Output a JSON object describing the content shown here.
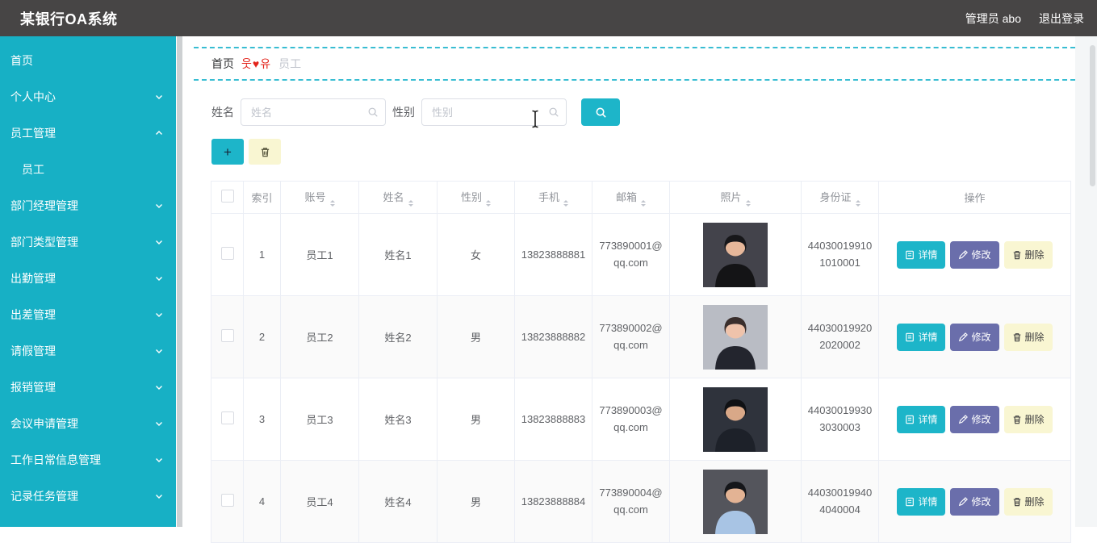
{
  "header": {
    "title": "某银行OA系统",
    "user": "管理员 abo",
    "logout": "退出登录"
  },
  "sidebar": {
    "items": [
      {
        "label": "首页",
        "arrow": ""
      },
      {
        "label": "个人中心",
        "arrow": "down"
      },
      {
        "label": "员工管理",
        "arrow": "up"
      },
      {
        "label": "员工",
        "arrow": "",
        "submenu": true
      },
      {
        "label": "部门经理管理",
        "arrow": "down"
      },
      {
        "label": "部门类型管理",
        "arrow": "down"
      },
      {
        "label": "出勤管理",
        "arrow": "down"
      },
      {
        "label": "出差管理",
        "arrow": "down"
      },
      {
        "label": "请假管理",
        "arrow": "down"
      },
      {
        "label": "报销管理",
        "arrow": "down"
      },
      {
        "label": "会议申请管理",
        "arrow": "down"
      },
      {
        "label": "工作日常信息管理",
        "arrow": "down"
      },
      {
        "label": "记录任务管理",
        "arrow": "down"
      }
    ]
  },
  "breadcrumb": {
    "home": "首页",
    "separator": "웃♥유",
    "current": "员工"
  },
  "search": {
    "name_label": "姓名",
    "name_placeholder": "姓名",
    "name_value": "",
    "gender_label": "性别",
    "gender_placeholder": "性别",
    "gender_value": ""
  },
  "toolbar": {
    "add_label": "+"
  },
  "table": {
    "columns": [
      {
        "label": "",
        "type": "checkbox"
      },
      {
        "label": "索引"
      },
      {
        "label": "账号",
        "sortable": true
      },
      {
        "label": "姓名",
        "sortable": true
      },
      {
        "label": "性别",
        "sortable": true
      },
      {
        "label": "手机",
        "sortable": true
      },
      {
        "label": "邮箱",
        "sortable": true
      },
      {
        "label": "照片",
        "sortable": true
      },
      {
        "label": "身份证",
        "sortable": true
      },
      {
        "label": "操作"
      }
    ],
    "actions": {
      "detail": "详情",
      "edit": "修改",
      "delete": "删除"
    },
    "rows": [
      {
        "index": "1",
        "account": "员工1",
        "name": "姓名1",
        "gender": "女",
        "phone": "13823888881",
        "email": "773890001@\nqq.com",
        "id_card": "44030019910\n1010001",
        "photo": {
          "bg": "#43434b",
          "hair": "#17171a",
          "skin": "#e6b79a",
          "cloth": "#141416"
        }
      },
      {
        "index": "2",
        "account": "员工2",
        "name": "姓名2",
        "gender": "男",
        "phone": "13823888882",
        "email": "773890002@\nqq.com",
        "id_card": "44030019920\n2020002",
        "photo": {
          "bg": "#b9bcc4",
          "hair": "#3a2e2c",
          "skin": "#efc3ab",
          "cloth": "#23252e"
        }
      },
      {
        "index": "3",
        "account": "员工3",
        "name": "姓名3",
        "gender": "男",
        "phone": "13823888883",
        "email": "773890003@\nqq.com",
        "id_card": "44030019930\n3030003",
        "photo": {
          "bg": "#2f333c",
          "hair": "#101114",
          "skin": "#d9a888",
          "cloth": "#1d2129"
        }
      },
      {
        "index": "4",
        "account": "员工4",
        "name": "姓名4",
        "gender": "男",
        "phone": "13823888884",
        "email": "773890004@\nqq.com",
        "id_card": "44030019940\n4040004",
        "photo": {
          "bg": "#54555c",
          "hair": "#15161a",
          "skin": "#e3b394",
          "cloth": "#a8c4e4"
        }
      }
    ]
  },
  "colors": {
    "accent_teal": "#1db5c9",
    "sidebar_teal": "#17b0c5",
    "header_bg": "#474545",
    "edit_purple": "#6a6eab",
    "delete_yellow": "#f9f6d2",
    "breadcrumb_red": "#e3241b"
  }
}
